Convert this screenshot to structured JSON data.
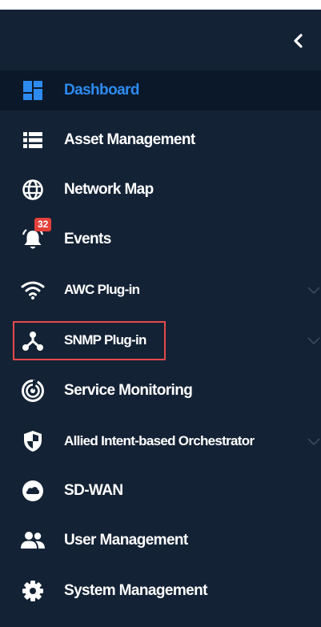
{
  "sidebar": {
    "collapse_glyph": "‹",
    "colors": {
      "background": "#142235",
      "active_background": "#0b1829",
      "active_text": "#2d8bf0",
      "badge": "#e5403a",
      "highlight_border": "#e64a4a"
    },
    "items": [
      {
        "label": "Dashboard",
        "icon": "dashboard-icon",
        "active": true
      },
      {
        "label": "Asset Management",
        "icon": "list-icon"
      },
      {
        "label": "Network Map",
        "icon": "globe-icon"
      },
      {
        "label": "Events",
        "icon": "bell-icon",
        "badge": "32"
      },
      {
        "label": "AWC Plug-in",
        "icon": "wifi-icon",
        "expandable": true
      },
      {
        "label": "SNMP Plug-in",
        "icon": "network-hub-icon",
        "expandable": true,
        "highlighted": true
      },
      {
        "label": "Service Monitoring",
        "icon": "radar-icon"
      },
      {
        "label": "Allied Intent-based Orchestrator",
        "icon": "shield-icon",
        "expandable": true
      },
      {
        "label": "SD-WAN",
        "icon": "cloud-icon"
      },
      {
        "label": "User Management",
        "icon": "users-icon"
      },
      {
        "label": "System Management",
        "icon": "gear-icon"
      }
    ]
  }
}
